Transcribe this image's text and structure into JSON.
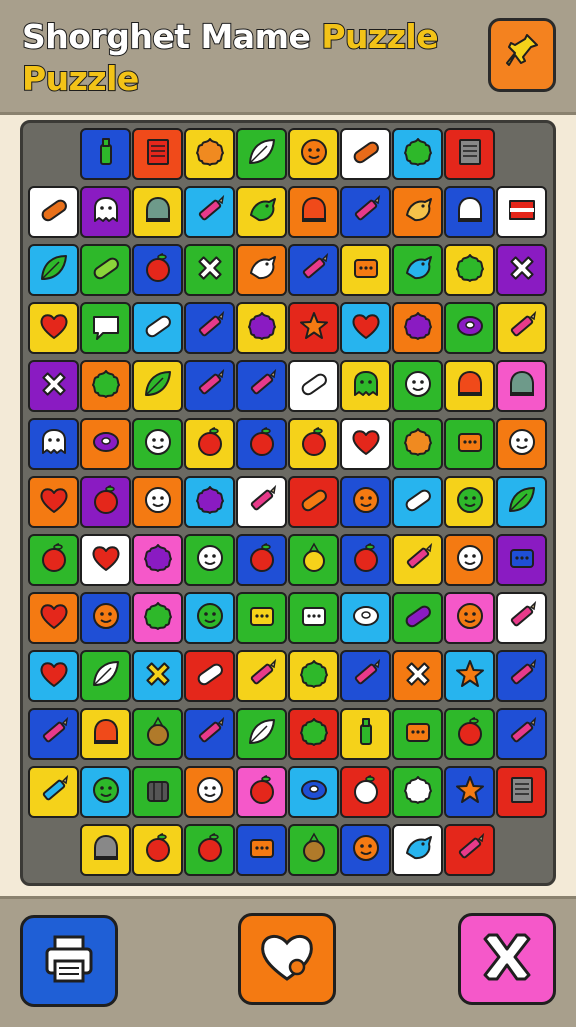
{
  "header": {
    "title_part1": "Shorghet Mame ",
    "title_highlight": "Puzzle",
    "title_line2": "Puzzle",
    "tool_icon": "pin-icon"
  },
  "board": {
    "rows": [
      [
        null,
        "blue:bottle",
        "orange-red:book",
        "yellow:flower",
        "green:leaf",
        "yellow:face",
        "white:pill",
        "sky:splat",
        "red:note",
        null
      ],
      [
        "white:candy",
        "purple:ghost",
        "yellow:helmet",
        "sky:crayon",
        "yellow:lizard",
        "orange:bell",
        "blue:crayon",
        "orange:figure",
        "blue:house",
        "white:flag"
      ],
      [
        "sky:leaf",
        "green:bean",
        "blue:apple",
        "green:cross",
        "orange:glove",
        "blue:crayon",
        "yellow:box",
        "green:bird",
        "yellow:splat",
        "purple:plug"
      ],
      [
        "yellow:heart",
        "green:speech",
        "sky:bandaid",
        "blue:crayon",
        "yellow:blob",
        "red:star",
        "sky:heart",
        "orange:blob",
        "green:disc",
        "yellow:crayon"
      ],
      [
        "purple:wrench",
        "orange:splat",
        "yellow:leaf",
        "blue:crayon",
        "blue:crayon",
        "white:bandaid",
        "yellow:frog",
        "green:smile",
        "yellow:bell",
        "pink:helmet"
      ],
      [
        "blue:panda",
        "orange:disc",
        "green:smile",
        "yellow:berry",
        "blue:apple",
        "yellow:apple",
        "white:heart",
        "green:flower",
        "green:box",
        "orange:face"
      ],
      [
        "orange:heart",
        "purple:apple",
        "orange:face",
        "sky:blob",
        "white:crayon",
        "red:carrot",
        "blue:face",
        "sky:glue",
        "yellow:smile",
        "sky:leaf"
      ],
      [
        "green:apple",
        "white:heart",
        "pink:blob",
        "green:smile",
        "blue:apple",
        "green:pear",
        "blue:apple",
        "yellow:crayon",
        "orange:face",
        "purple:dots"
      ],
      [
        "orange:heart",
        "blue:face",
        "pink:splat",
        "sky:smile",
        "green:block",
        "green:cracker",
        "sky:cookie",
        "green:eggplant",
        "pink:face",
        "white:crayon"
      ],
      [
        "sky:heart",
        "green:leaf",
        "sky:hook",
        "red:hammer",
        "yellow:crayon",
        "yellow:splat",
        "blue:crayon",
        "orange:arrow",
        "sky:star",
        "blue:crayon"
      ],
      [
        "blue:crayon",
        "yellow:bell",
        "green:pineapple",
        "blue:crayon",
        "green:leaf",
        "red:splat",
        "yellow:bottle",
        "green:box",
        "green:apple",
        "blue:crayon"
      ],
      [
        "yellow:brush",
        "sky:smile",
        "green:cage",
        "orange:face",
        "pink:apple",
        "sky:donut",
        "red:apple",
        "green:splat",
        "blue:star",
        "red:note"
      ],
      [
        null,
        "yellow:cat",
        "yellow:apple",
        "green:apple",
        "blue:box",
        "green:pineapple",
        "blue:face",
        "white:bird",
        "red:crayon",
        null
      ]
    ]
  },
  "footer": {
    "left_icon": "printer-icon",
    "center_icon": "heart-icon",
    "right_icon": "crossed-tools-icon"
  },
  "colors": {
    "blue": "#1f4fd6",
    "orange-red": "#f04a1a",
    "yellow": "#f5d21a",
    "green": "#2eb82a",
    "white": "#ffffff",
    "sky": "#27b4ee",
    "red": "#e4271b",
    "purple": "#8a1bc2",
    "orange": "#f47a12",
    "pink": "#f558c9"
  },
  "icon_colors": {
    "bottle": "#2eb82a",
    "book": "#e4271b",
    "flower": "#f08a20",
    "leaf": "#2eb82a",
    "face": "#f47a12",
    "pill": "#e86b1a",
    "splat": "#2eb82a",
    "note": "#888888",
    "candy": "#e8701a",
    "ghost": "#ffffff",
    "helmet": "#6e9a8a",
    "crayon": "#e83a8a",
    "lizard": "#2eb82a",
    "bell": "#f04a1a",
    "figure": "#f5c24a",
    "house": "#ffffff",
    "flag": "#e4271b",
    "bean": "#8ad43a",
    "apple": "#e4271b",
    "cross": "#2eb82a",
    "glove": "#ffffff",
    "box": "#f47a12",
    "bird": "#27b4ee",
    "plug": "#ffffff",
    "heart": "#e4271b",
    "speech": "#ffffff",
    "bandaid": "#ffffff",
    "blob": "#8a1bc2",
    "star": "#f47a12",
    "disc": "#8a1bc2",
    "wrench": "#ffffff",
    "frog": "#2eb82a",
    "smile": "#2eb82a",
    "panda": "#ffffff",
    "berry": "#e4271b",
    "carrot": "#f47a12",
    "glue": "#ffffff",
    "pear": "#f5d21a",
    "dots": "#1f4fd6",
    "block": "#f5d21a",
    "cracker": "#2eb82a",
    "cookie": "#ffffff",
    "eggplant": "#8a1bc2",
    "hook": "#f5d21a",
    "hammer": "#ffffff",
    "arrow": "#ffffff",
    "pineapple": "#b07a2a",
    "brush": "#27b4ee",
    "cage": "#555555",
    "donut": "#1f4fd6",
    "cat": "#888888"
  }
}
